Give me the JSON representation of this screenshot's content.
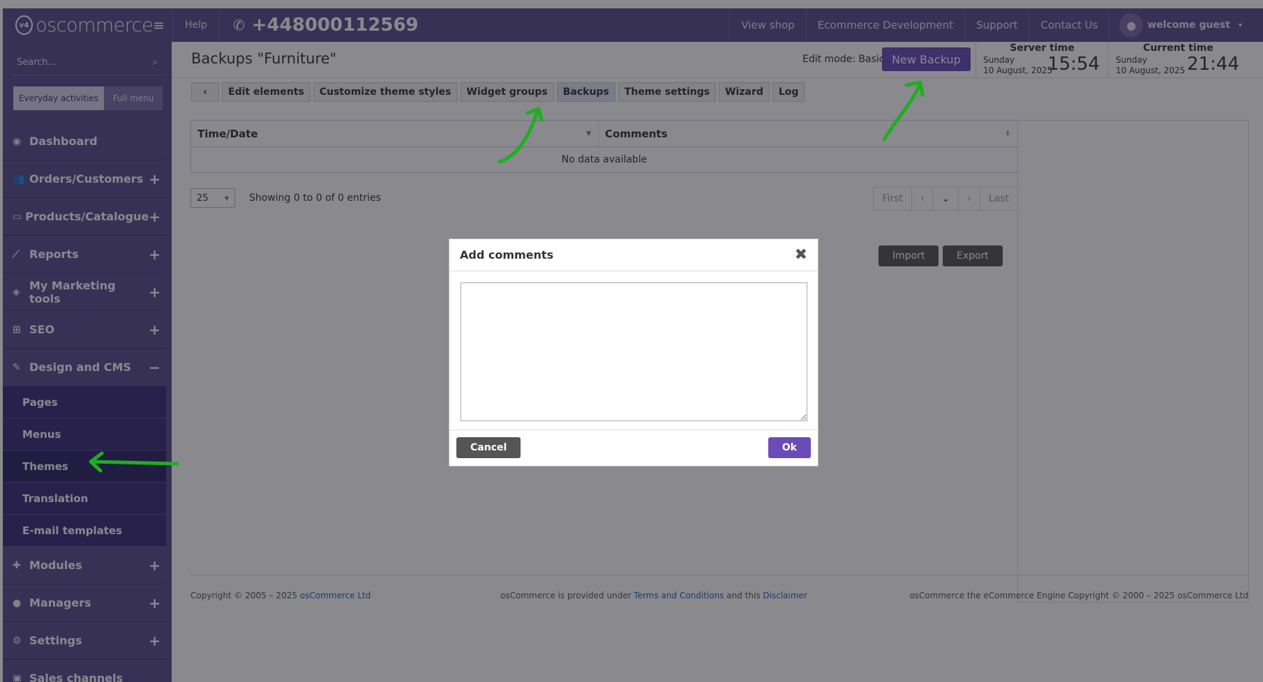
{
  "topbar": {
    "logo_mark": "v4",
    "logo_text": "oscommerce",
    "help": "Help",
    "phone": "+448000112569",
    "nav": [
      "View shop",
      "Ecommerce Development",
      "Support",
      "Contact Us"
    ],
    "user": "welcome guest"
  },
  "sidebar": {
    "search_placeholder": "Search...",
    "mode_everyday": "Everyday activities",
    "mode_full": "Full menu",
    "items": [
      {
        "label": "Dashboard",
        "icon": "dashboard-icon",
        "sign": ""
      },
      {
        "label": "Orders/Customers",
        "icon": "users-icon",
        "sign": "+"
      },
      {
        "label": "Products/Catalogue",
        "icon": "folder-icon",
        "sign": "+"
      },
      {
        "label": "Reports",
        "icon": "chart-icon",
        "sign": "+"
      },
      {
        "label": "My Marketing tools",
        "icon": "tag-icon",
        "sign": "+"
      },
      {
        "label": "SEO",
        "icon": "sitemap-icon",
        "sign": "+"
      },
      {
        "label": "Design and CMS",
        "icon": "brush-icon",
        "sign": "−"
      }
    ],
    "subitems": [
      "Pages",
      "Menus",
      "Themes",
      "Translation",
      "E-mail templates"
    ],
    "items_after": [
      {
        "label": "Modules",
        "icon": "puzzle-icon",
        "sign": "+"
      },
      {
        "label": "Managers",
        "icon": "user-icon",
        "sign": "+"
      },
      {
        "label": "Settings",
        "icon": "gears-icon",
        "sign": "+"
      },
      {
        "label": "Sales channels",
        "icon": "monitor-icon",
        "sign": ""
      }
    ]
  },
  "header": {
    "title": "Backups \"Furniture\"",
    "edit_mode": "Edit mode: Basic",
    "new_backup": "New Backup",
    "server_time_label": "Server time",
    "server_day": "Sunday",
    "server_date": "10 August, 2025",
    "server_time": "15:54",
    "current_time_label": "Current time",
    "current_day": "Sunday",
    "current_date": "10 August, 2025",
    "current_time": "21:44"
  },
  "tabs": [
    "Edit elements",
    "Customize theme styles",
    "Widget groups",
    "Backups",
    "Theme settings",
    "Wizard",
    "Log"
  ],
  "table": {
    "col_time": "Time/Date",
    "col_comments": "Comments",
    "empty": "No data available"
  },
  "pager": {
    "per_page": "25",
    "showing": "Showing 0 to 0 of 0 entries",
    "first": "First",
    "last": "Last"
  },
  "actions": {
    "import": "Import",
    "export": "Export"
  },
  "footer": {
    "copyright": "Copyright © 2005 – 2025 ",
    "company": "osCommerce Ltd",
    "provided": "osCommerce is provided under ",
    "terms": "Terms and Conditions",
    "and_this": " and this ",
    "disclaimer": "Disclaimer",
    "engine": "osCommerce the eCommerce Engine Copyright © 2000 – 2025 osCommerce Ltd"
  },
  "modal": {
    "title": "Add comments",
    "cancel": "Cancel",
    "ok": "Ok"
  },
  "colors": {
    "brand": "#5d4e8e",
    "accent": "#6a4bb8",
    "annotation": "#1fae1f"
  }
}
